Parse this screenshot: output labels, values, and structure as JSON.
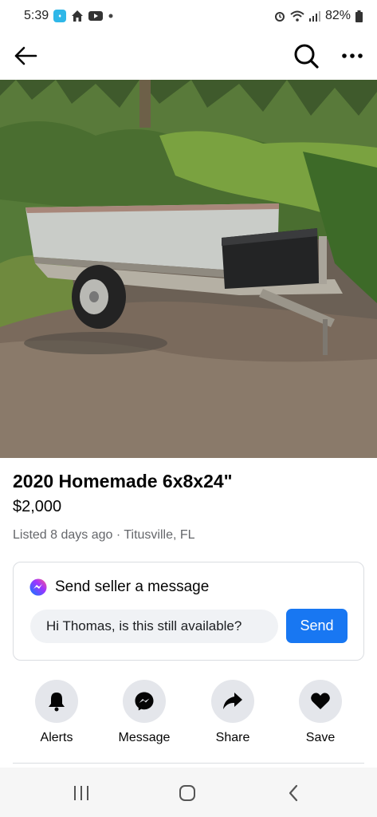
{
  "status_bar": {
    "time": "5:39",
    "battery": "82%",
    "left_icons": [
      "app-badge-icon",
      "home-icon",
      "youtube-icon",
      "dot-icon"
    ],
    "right_icons": [
      "alarm-icon",
      "wifi-icon",
      "signal-icon",
      "battery-icon"
    ]
  },
  "top_bar": {
    "icons": [
      "back-arrow-icon",
      "search-icon",
      "more-icon"
    ]
  },
  "photo": {
    "carousel_count": 5,
    "active_index": 2
  },
  "listing": {
    "title": "2020 Homemade 6x8x24\"",
    "price": "$2,000",
    "meta": "Listed 8 days ago · Titusville, FL"
  },
  "message": {
    "heading": "Send seller a message",
    "input_value": "Hi Thomas, is this still available?",
    "send_label": "Send"
  },
  "actions": [
    {
      "label": "Alerts",
      "icon": "bell-icon"
    },
    {
      "label": "Message",
      "icon": "messenger-icon"
    },
    {
      "label": "Share",
      "icon": "share-icon"
    },
    {
      "label": "Save",
      "icon": "heart-icon"
    }
  ],
  "nav_bar": {
    "icons": [
      "recent-apps-icon",
      "home-button-icon",
      "back-nav-icon"
    ]
  },
  "colors": {
    "accent": "#1877f2",
    "text": "#050505",
    "secondary_text": "#65676b",
    "action_bg": "#e4e6eb"
  }
}
